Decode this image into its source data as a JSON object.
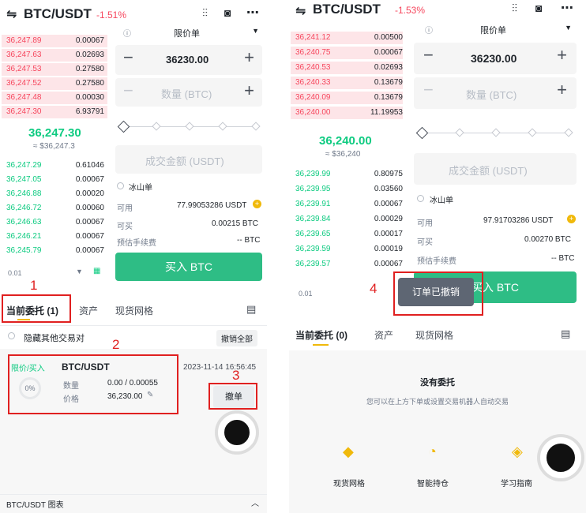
{
  "left": {
    "title": "BTC/USDT",
    "change": "-1.51%",
    "asks": [
      {
        "price": "36,247.89",
        "qty": "0.00067"
      },
      {
        "price": "36,247.63",
        "qty": "0.02693"
      },
      {
        "price": "36,247.53",
        "qty": "0.27580"
      },
      {
        "price": "36,247.52",
        "qty": "0.27580"
      },
      {
        "price": "36,247.48",
        "qty": "0.00030"
      },
      {
        "price": "36,247.30",
        "qty": "6.93791"
      }
    ],
    "mid_price": "36,247.30",
    "mid_usd": "≈ $36,247.3",
    "bids": [
      {
        "price": "36,247.29",
        "qty": "0.61046"
      },
      {
        "price": "36,247.05",
        "qty": "0.00067"
      },
      {
        "price": "36,246.88",
        "qty": "0.00020"
      },
      {
        "price": "36,246.72",
        "qty": "0.00060"
      },
      {
        "price": "36,246.63",
        "qty": "0.00067"
      },
      {
        "price": "36,246.21",
        "qty": "0.00067"
      },
      {
        "price": "36,245.79",
        "qty": "0.00067"
      }
    ],
    "depth_step": "0.01",
    "order_type": "限价单",
    "price_value": "36230.00",
    "qty_placeholder": "数量 (BTC)",
    "amount_placeholder": "成交金额 (USDT)",
    "iceberg": "冰山单",
    "available_label": "可用",
    "available_value": "77.99053286 USDT",
    "buyable_label": "可买",
    "buyable_value": "0.00215 BTC",
    "fee_label": "预估手续费",
    "fee_value": "-- BTC",
    "buy_button": "买入 BTC",
    "tabs": [
      "当前委托 (1)",
      "资产",
      "现货网格"
    ],
    "hide_pairs": "隐藏其他交易对",
    "cancel_all": "撤销全部",
    "order": {
      "type": "限价/买入",
      "pair": "BTC/USDT",
      "time": "2023-11-14 16:56:45",
      "progress": "0%",
      "qty_label": "数量",
      "qty_value": "0.00 / 0.00055",
      "price_label": "价格",
      "price_value": "36,230.00",
      "cancel": "撤单"
    },
    "chart_bar": "BTC/USDT 图表",
    "annotations": [
      "1",
      "2",
      "3"
    ]
  },
  "right": {
    "title": "BTC/USDT",
    "change": "-1.53%",
    "asks": [
      {
        "price": "36,241.12",
        "qty": "0.00500"
      },
      {
        "price": "36,240.75",
        "qty": "0.00067"
      },
      {
        "price": "36,240.53",
        "qty": "0.02693"
      },
      {
        "price": "36,240.33",
        "qty": "0.13679"
      },
      {
        "price": "36,240.09",
        "qty": "0.13679"
      },
      {
        "price": "36,240.00",
        "qty": "11.19953"
      }
    ],
    "mid_price": "36,240.00",
    "mid_usd": "≈ $36,240",
    "bids": [
      {
        "price": "36,239.99",
        "qty": "0.80975"
      },
      {
        "price": "36,239.95",
        "qty": "0.03560"
      },
      {
        "price": "36,239.91",
        "qty": "0.00067"
      },
      {
        "price": "36,239.84",
        "qty": "0.00029"
      },
      {
        "price": "36,239.65",
        "qty": "0.00017"
      },
      {
        "price": "36,239.59",
        "qty": "0.00019"
      },
      {
        "price": "36,239.57",
        "qty": "0.00067"
      }
    ],
    "depth_step": "0.01",
    "order_type": "限价单",
    "price_value": "36230.00",
    "qty_placeholder": "数量 (BTC)",
    "amount_placeholder": "成交金额 (USDT)",
    "iceberg": "冰山单",
    "available_label": "可用",
    "available_value": "97.91703286 USDT",
    "buyable_label": "可买",
    "buyable_value": "0.00270 BTC",
    "fee_label": "预估手续费",
    "fee_value": "-- BTC",
    "buy_button": "买入 BTC",
    "toast": "订单已撤销",
    "tabs": [
      "当前委托 (0)",
      "资产",
      "现货网格"
    ],
    "empty_title": "没有委托",
    "empty_sub": "您可以在上方下单或设置交易机器人自动交易",
    "bottom_actions": [
      "现货网格",
      "智能持仓",
      "学习指南"
    ],
    "annotation": "4"
  },
  "colors": {
    "ask": "#f6465d",
    "bid": "#0ecb81",
    "buy": "#2ebd85",
    "annotation": "#e02020"
  }
}
